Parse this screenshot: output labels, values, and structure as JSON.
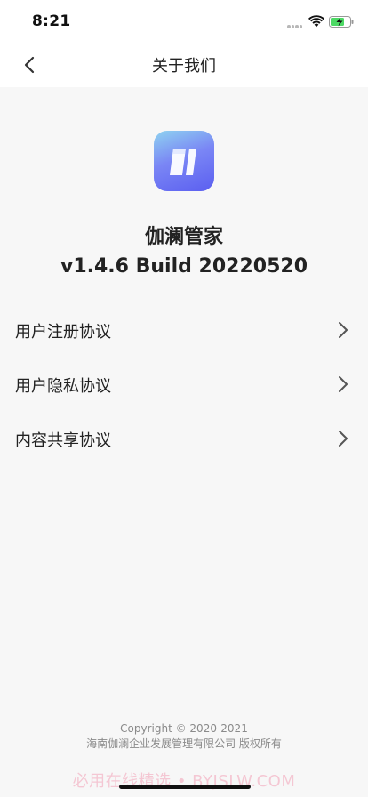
{
  "status_bar": {
    "time": "8:21"
  },
  "nav": {
    "title": "关于我们"
  },
  "app": {
    "name": "伽澜管家",
    "version": "v1.4.6 Build 20220520"
  },
  "menu": {
    "items": [
      {
        "label": "用户注册协议",
        "icon": "chevron-right-icon"
      },
      {
        "label": "用户隐私协议",
        "icon": "chevron-right-icon"
      },
      {
        "label": "内容共享协议",
        "icon": "chevron-right-icon"
      }
    ]
  },
  "footer": {
    "copyright": "Copyright © 2020-2021",
    "company": "海南伽澜企业发展管理有限公司 版权所有"
  },
  "watermark": {
    "text": "必用在线精选 • BYJSLW.COM"
  },
  "colors": {
    "background": "#f7f7f7",
    "battery_fill": "#4cd964",
    "logo_gradient_start": "#8fd3f0",
    "logo_gradient_end": "#5b5ff0"
  }
}
